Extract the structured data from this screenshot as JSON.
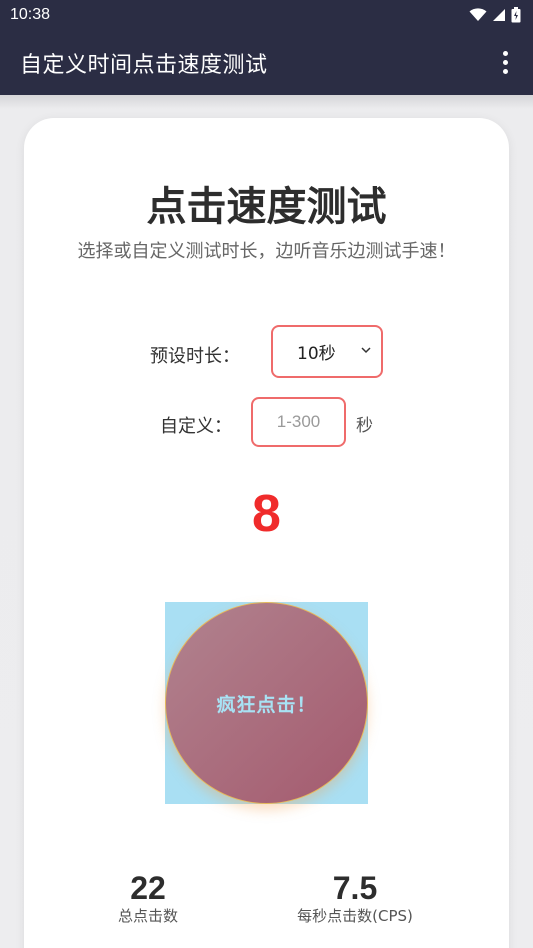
{
  "status_bar": {
    "time": "10:38",
    "icons": [
      "wifi-icon",
      "signal-icon",
      "battery-icon"
    ]
  },
  "app_bar": {
    "title": "自定义时间点击速度测试",
    "menu_icon": "more-vert-icon"
  },
  "main": {
    "title": "点击速度测试",
    "subtitle": "选择或自定义测试时长，边听音乐边测试手速！",
    "preset_label": "预设时长：",
    "preset_selected": "10秒",
    "custom_label": "自定义：",
    "custom_placeholder": "1-300",
    "custom_value": "",
    "custom_unit": "秒",
    "timer_value": "8",
    "tap_button_label": "疯狂点击！",
    "stats": {
      "total_clicks_value": "22",
      "total_clicks_label": "总点击数",
      "cps_value": "7.5",
      "cps_label": "每秒点击数(CPS)"
    }
  },
  "colors": {
    "app_bar_bg": "#2b2d44",
    "accent_border": "#ef6b6b",
    "timer_red": "#f02b2b",
    "tap_area_bg": "#a9dff3",
    "tap_button": "#a45a6e"
  }
}
